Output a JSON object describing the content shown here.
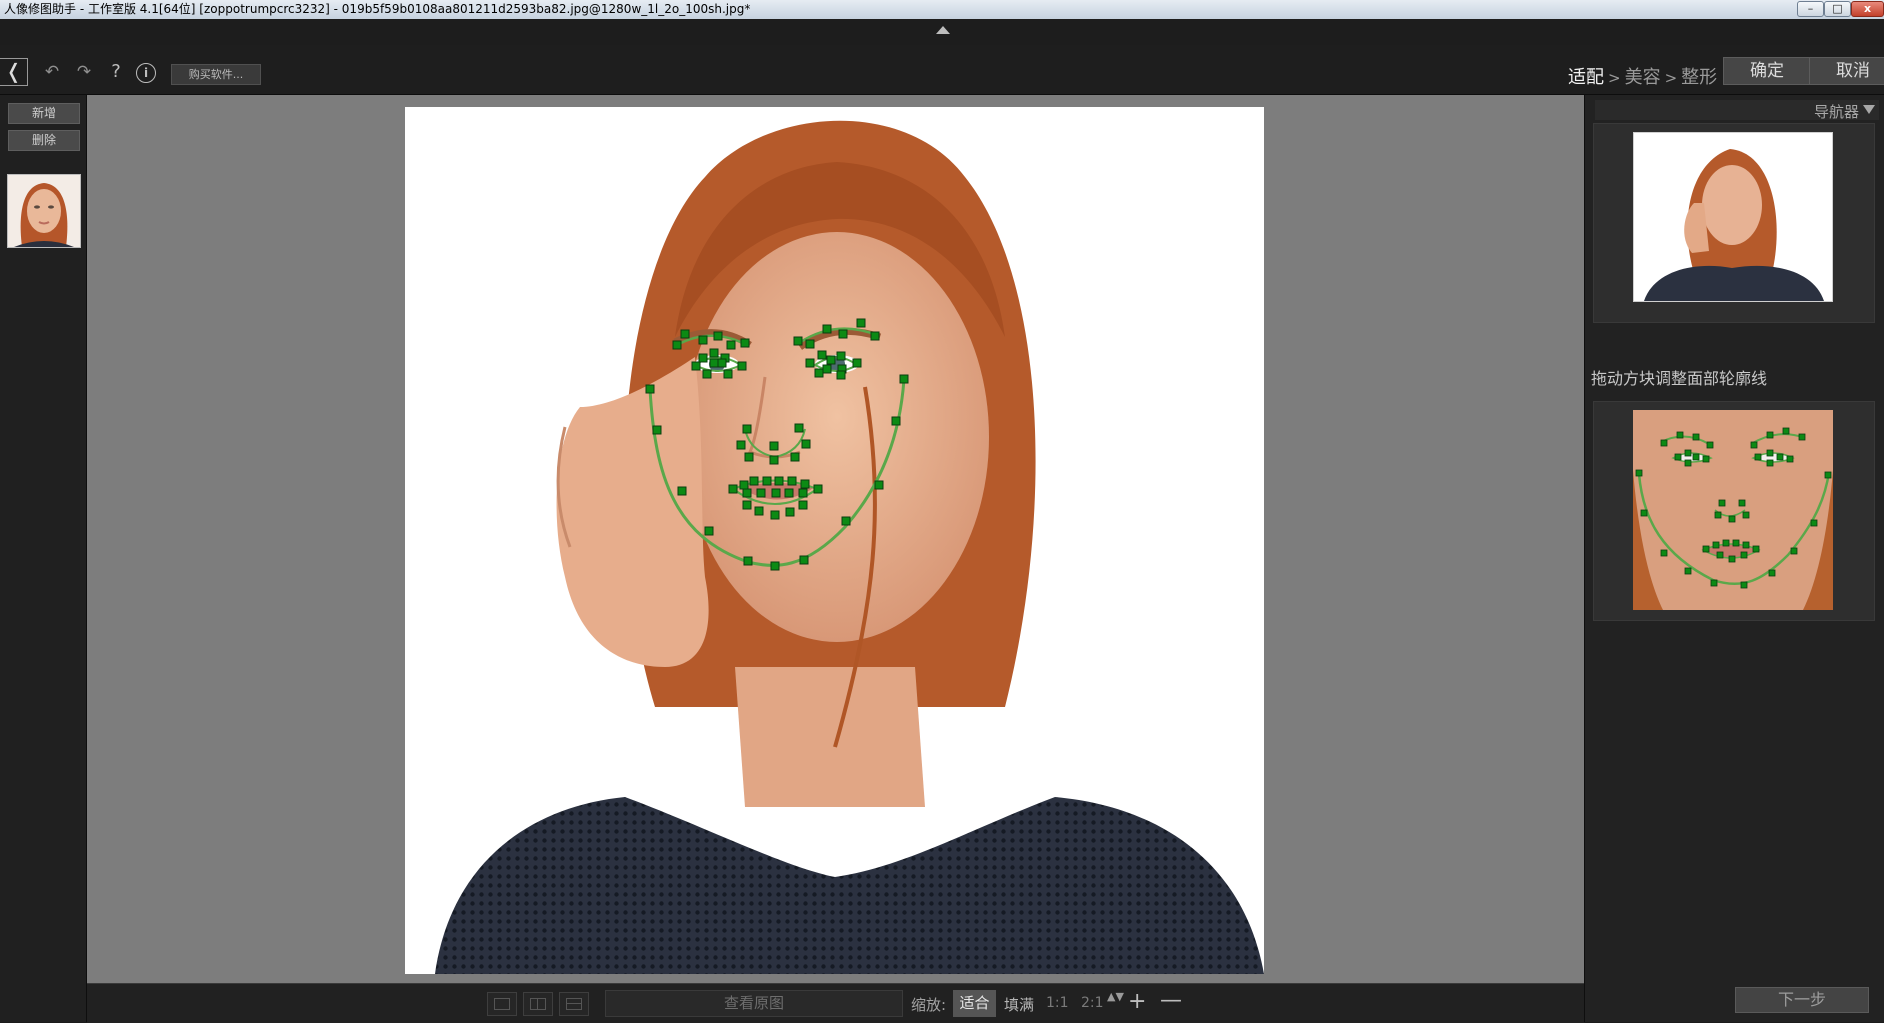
{
  "window": {
    "title": "人像修图助手 - 工作室版 4.1[64位] [zoppotrumpcrc3232] - 019b5f59b0108aa801211d2593ba82.jpg@1280w_1l_2o_100sh.jpg*",
    "minimize_glyph": "–",
    "maximize_glyph": "□",
    "close_glyph": "x"
  },
  "toolbar": {
    "logo_glyph": "❬",
    "undo_glyph": "↶",
    "redo_glyph": "↷",
    "help_glyph": "?",
    "info_glyph": "i",
    "buy_label": "购买软件...",
    "breadcrumb": {
      "current": "适配",
      "sep1": ">",
      "step2": "美容",
      "sep2": ">",
      "step3": "整形"
    },
    "confirm_label": "确定",
    "cancel_label": "取消"
  },
  "left_panel": {
    "add_label": "新增",
    "delete_label": "删除"
  },
  "bottom_bar": {
    "view_original_label": "查看原图",
    "zoom_label": "缩放:",
    "zoom_fit": "适合",
    "zoom_fill": "填满",
    "zoom_1_1": "1:1",
    "zoom_2_1": "2:1",
    "zoom_step_glyph": "▲▼",
    "zoom_in_glyph": "+",
    "zoom_out_glyph": "—"
  },
  "right_panel": {
    "navigator_title": "导航器",
    "hint": "拖动方块调整面部轮廓线",
    "next_label": "下一步"
  },
  "colors": {
    "accent_green": "#0c8a14",
    "contour_green": "#5aa84a",
    "canvas_gray": "#7d7d7d",
    "panel_dark": "#1e1e1e"
  }
}
